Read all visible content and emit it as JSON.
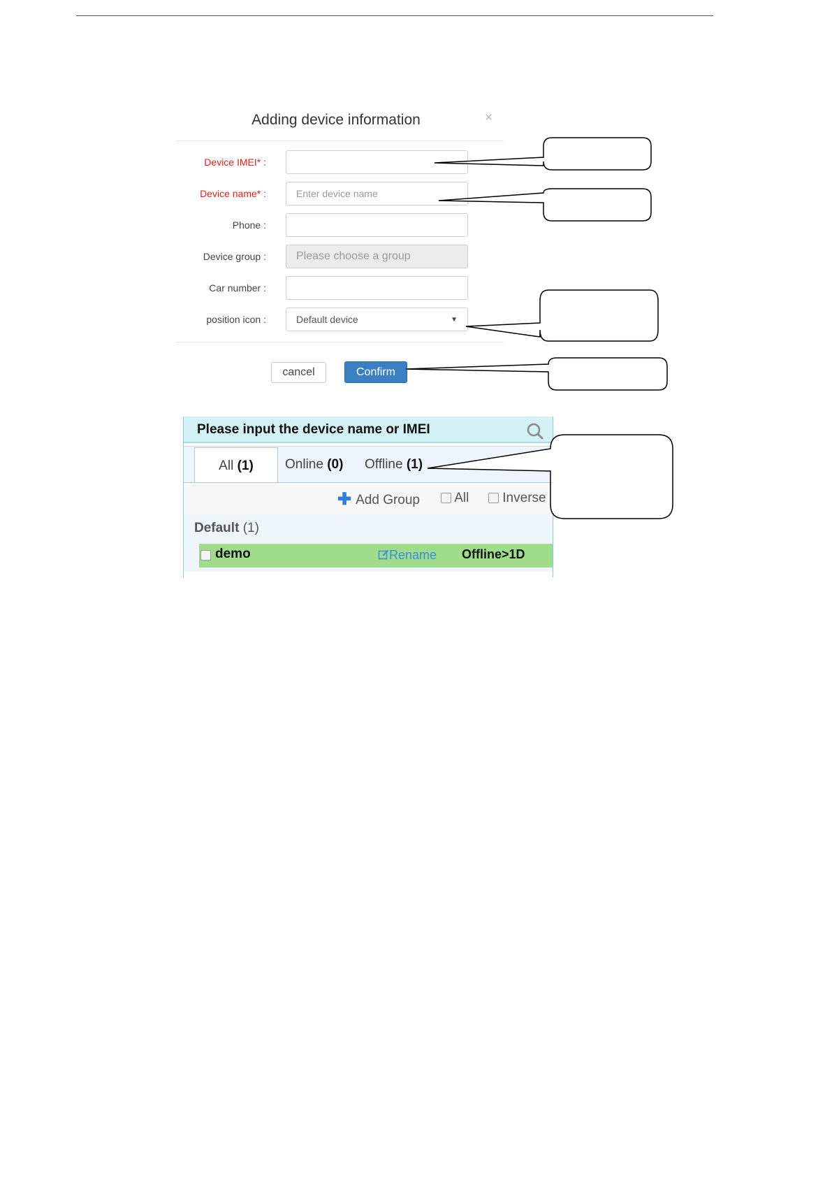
{
  "dialog": {
    "title": "Adding device information",
    "close_symbol": "×",
    "fields": {
      "imei": {
        "label": "Device IMEI* :",
        "value": "",
        "placeholder": ""
      },
      "device_name": {
        "label": "Device name* :",
        "value": "",
        "placeholder": "Enter device name"
      },
      "phone": {
        "label": "Phone :",
        "value": "",
        "placeholder": ""
      },
      "device_group": {
        "label": "Device group :",
        "value": "",
        "placeholder": "Please choose a group"
      },
      "car_number": {
        "label": "Car number :",
        "value": "",
        "placeholder": ""
      },
      "position_icon": {
        "label": "position icon :",
        "selected": "Default device"
      }
    },
    "cancel_label": "cancel",
    "confirm_label": "Confirm"
  },
  "device_list": {
    "search_placeholder": "Please input the device name or IMEI",
    "tabs": [
      {
        "label": "All",
        "count": "(1)"
      },
      {
        "label": "Online",
        "count": "(0)"
      },
      {
        "label": "Offline",
        "count": "(1)"
      }
    ],
    "add_group_label": "Add Group",
    "select_all_label": "All",
    "inverse_label": "Inverse",
    "group": {
      "name": "Default",
      "count": "(1)"
    },
    "device": {
      "name": "demo",
      "rename_label": "Rename",
      "status": "Offline>1D"
    }
  },
  "colors": {
    "required_label": "#e02020",
    "confirm_button": "#3a7fc1",
    "search_bar": "#d2f2f8",
    "offline_row": "#9fdc8c",
    "rename_link": "#3b8fd6"
  },
  "icons": [
    "close-icon",
    "dropdown-arrow-icon",
    "search-icon",
    "plus-icon",
    "edit-icon",
    "checkbox-icon"
  ]
}
